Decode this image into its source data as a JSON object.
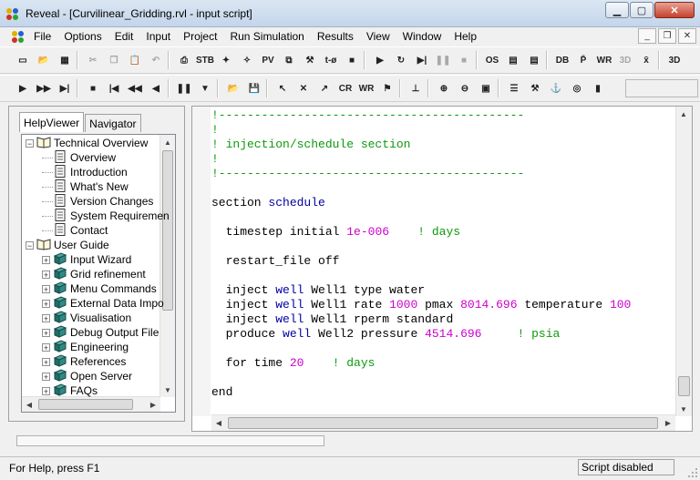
{
  "window": {
    "title": "Reveal - [Curvilinear_Gridding.rvl - input script]"
  },
  "menu": {
    "items": [
      "File",
      "Options",
      "Edit",
      "Input",
      "Project",
      "Run Simulation",
      "Results",
      "View",
      "Window",
      "Help"
    ]
  },
  "toolbar1": [
    {
      "icon": "new-document-icon",
      "glyph": "▭"
    },
    {
      "icon": "open-folder-icon",
      "glyph": "📂"
    },
    {
      "icon": "save-all-icon",
      "glyph": "▦"
    },
    {
      "icon": "cut-icon",
      "glyph": "✂",
      "disabled": true
    },
    {
      "icon": "copy-icon",
      "glyph": "❐",
      "disabled": true
    },
    {
      "icon": "paste-icon",
      "glyph": "📋"
    },
    {
      "icon": "undo-icon",
      "glyph": "↶",
      "disabled": true
    },
    {
      "icon": "print-icon",
      "glyph": "⎙"
    },
    {
      "icon": "stb-units-icon",
      "glyph": "STB"
    },
    {
      "icon": "input-wizard-icon",
      "glyph": "✦"
    },
    {
      "icon": "magic-wand-icon",
      "glyph": "✧"
    },
    {
      "icon": "pvt-icon",
      "glyph": "PV"
    },
    {
      "icon": "network-icon",
      "glyph": "⧉"
    },
    {
      "icon": "well-icon",
      "glyph": "⚒"
    },
    {
      "icon": "time-zero-icon",
      "glyph": "t-ø"
    },
    {
      "icon": "grid-icon",
      "glyph": "■"
    },
    {
      "icon": "run-icon",
      "glyph": "▶"
    },
    {
      "icon": "restart-icon",
      "glyph": "↻"
    },
    {
      "icon": "step-icon",
      "glyph": "▶|"
    },
    {
      "icon": "pause-icon",
      "glyph": "❚❚",
      "disabled": true
    },
    {
      "icon": "stop-icon",
      "glyph": "■",
      "disabled": true
    },
    {
      "icon": "os-icon",
      "glyph": "OS"
    },
    {
      "icon": "script-icon",
      "glyph": "▤"
    },
    {
      "icon": "script-b-icon",
      "glyph": "▤"
    },
    {
      "icon": "database-icon",
      "glyph": "DB"
    },
    {
      "icon": "p-bar-icon",
      "glyph": "P̄"
    },
    {
      "icon": "wr-icon",
      "glyph": "WR"
    },
    {
      "icon": "3d-icon",
      "glyph": "3D",
      "disabled": true
    },
    {
      "icon": "x-bar-icon",
      "glyph": "x̄"
    },
    {
      "icon": "no-3d-icon",
      "glyph": "3D"
    }
  ],
  "toolbar2": [
    {
      "icon": "play-icon",
      "glyph": "▶"
    },
    {
      "icon": "fast-forward-icon",
      "glyph": "▶▶"
    },
    {
      "icon": "end-icon",
      "glyph": "▶|"
    },
    {
      "icon": "stop-icon",
      "glyph": "■"
    },
    {
      "icon": "first-icon",
      "glyph": "|◀"
    },
    {
      "icon": "rewind-icon",
      "glyph": "◀◀"
    },
    {
      "icon": "back-icon",
      "glyph": "◀"
    },
    {
      "icon": "pause-icon",
      "glyph": "❚❚"
    },
    {
      "icon": "down-icon",
      "glyph": "▼"
    },
    {
      "icon": "open-icon",
      "glyph": "📂"
    },
    {
      "icon": "save-icon",
      "glyph": "💾"
    },
    {
      "icon": "pointer-icon",
      "glyph": "↖"
    },
    {
      "icon": "delete-pointer-icon",
      "glyph": "✕"
    },
    {
      "icon": "zoom-pointer-icon",
      "glyph": "↗"
    },
    {
      "icon": "cr-icon",
      "glyph": "CR"
    },
    {
      "icon": "wr-icon",
      "glyph": "WR"
    },
    {
      "icon": "flag-icon",
      "glyph": "⚑"
    },
    {
      "icon": "axis-icon",
      "glyph": "⊥"
    },
    {
      "icon": "zoom-in-icon",
      "glyph": "⊕"
    },
    {
      "icon": "zoom-out-icon",
      "glyph": "⊖"
    },
    {
      "icon": "zoom-fit-icon",
      "glyph": "▣"
    },
    {
      "icon": "list-icon",
      "glyph": "☰"
    },
    {
      "icon": "tools-icon",
      "glyph": "⚒"
    },
    {
      "icon": "anchor-icon",
      "glyph": "⚓"
    },
    {
      "icon": "target-icon",
      "glyph": "◎"
    },
    {
      "icon": "book-icon",
      "glyph": "▮"
    }
  ],
  "tabs": {
    "helpviewer": "HelpViewer",
    "navigator": "Navigator"
  },
  "tree": [
    {
      "label": "Technical Overview",
      "level": 0,
      "expander": "−",
      "icon": "book-open-icon"
    },
    {
      "label": "Overview",
      "level": 1,
      "icon": "page-icon"
    },
    {
      "label": "Introduction",
      "level": 1,
      "icon": "page-icon"
    },
    {
      "label": "What's New",
      "level": 1,
      "icon": "page-icon"
    },
    {
      "label": "Version Changes",
      "level": 1,
      "icon": "page-icon"
    },
    {
      "label": "System Requiremen",
      "level": 1,
      "icon": "page-icon"
    },
    {
      "label": "Contact",
      "level": 1,
      "icon": "page-icon"
    },
    {
      "label": "User Guide",
      "level": 0,
      "expander": "−",
      "icon": "book-open-icon"
    },
    {
      "label": "Input Wizard",
      "level": 1,
      "expander": "+",
      "icon": "book-closed-icon"
    },
    {
      "label": "Grid refinement",
      "level": 1,
      "expander": "+",
      "icon": "book-closed-icon"
    },
    {
      "label": "Menu Commands",
      "level": 1,
      "expander": "+",
      "icon": "book-closed-icon"
    },
    {
      "label": "External Data Impo",
      "level": 1,
      "expander": "+",
      "icon": "book-closed-icon"
    },
    {
      "label": "Visualisation",
      "level": 1,
      "expander": "+",
      "icon": "book-closed-icon"
    },
    {
      "label": "Debug Output File",
      "level": 1,
      "expander": "+",
      "icon": "book-closed-icon"
    },
    {
      "label": "Engineering",
      "level": 1,
      "expander": "+",
      "icon": "book-closed-icon"
    },
    {
      "label": "References",
      "level": 1,
      "expander": "+",
      "icon": "book-closed-icon"
    },
    {
      "label": "Open Server",
      "level": 1,
      "expander": "+",
      "icon": "book-closed-icon"
    },
    {
      "label": "FAQs",
      "level": 1,
      "expander": "+",
      "icon": "book-closed-icon"
    }
  ],
  "code_lines": [
    [
      [
        "cmt",
        "!-------------------------------------------"
      ]
    ],
    [
      [
        "cmt",
        "!"
      ]
    ],
    [
      [
        "cmt",
        "! injection/schedule section"
      ]
    ],
    [
      [
        "cmt",
        "!"
      ]
    ],
    [
      [
        "cmt",
        "!-------------------------------------------"
      ]
    ],
    [],
    [
      [
        "plain",
        "section "
      ],
      [
        "kw",
        "schedule"
      ]
    ],
    [],
    [
      [
        "plain",
        "  timestep initial "
      ],
      [
        "num",
        "1e-006"
      ],
      [
        "plain",
        "    "
      ],
      [
        "cmt",
        "! days"
      ]
    ],
    [],
    [
      [
        "plain",
        "  restart_file off"
      ]
    ],
    [],
    [
      [
        "plain",
        "  inject "
      ],
      [
        "kw",
        "well"
      ],
      [
        "plain",
        " Well1 type water"
      ]
    ],
    [
      [
        "plain",
        "  inject "
      ],
      [
        "kw",
        "well"
      ],
      [
        "plain",
        " Well1 rate "
      ],
      [
        "num",
        "1000"
      ],
      [
        "plain",
        " pmax "
      ],
      [
        "num",
        "8014.696"
      ],
      [
        "plain",
        " temperature "
      ],
      [
        "num",
        "100"
      ]
    ],
    [
      [
        "plain",
        "  inject "
      ],
      [
        "kw",
        "well"
      ],
      [
        "plain",
        " Well1 rperm standard"
      ]
    ],
    [
      [
        "plain",
        "  produce "
      ],
      [
        "kw",
        "well"
      ],
      [
        "plain",
        " Well2 pressure "
      ],
      [
        "num",
        "4514.696"
      ],
      [
        "plain",
        "     "
      ],
      [
        "cmt",
        "! psia"
      ]
    ],
    [],
    [
      [
        "plain",
        "  for time "
      ],
      [
        "num",
        "20"
      ],
      [
        "plain",
        "    "
      ],
      [
        "cmt",
        "! days"
      ]
    ],
    [],
    [
      [
        "plain",
        "end"
      ]
    ]
  ],
  "status": {
    "help": "For Help, press F1",
    "script": "Script disabled"
  }
}
